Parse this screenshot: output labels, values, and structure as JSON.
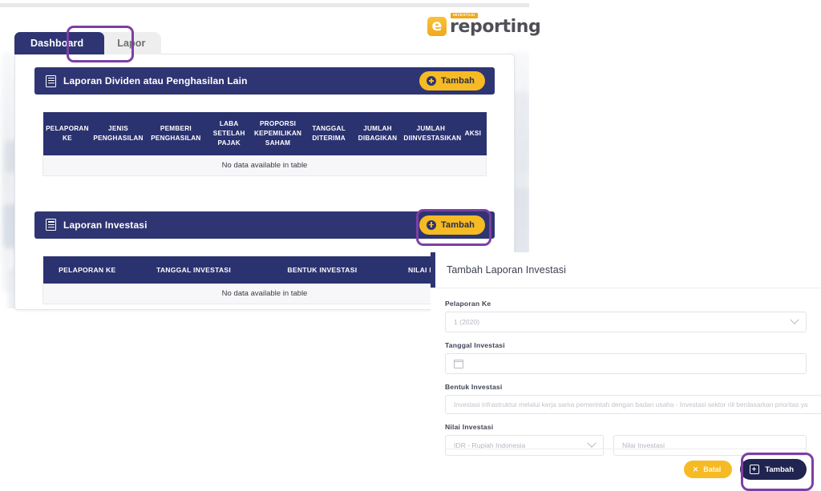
{
  "brand": {
    "mark_letter": "e",
    "badge": "INVESTASI",
    "word": "reporting"
  },
  "tabs": [
    {
      "label": "Dashboard",
      "state": "active"
    },
    {
      "label": "Lapor",
      "state": "highlighted"
    }
  ],
  "colors": {
    "navy": "#2e3572",
    "table_header_navy": "#2b3270",
    "amber": "#f6ba24",
    "highlight_purple": "#7c3fa5",
    "dark_button": "#1f2450"
  },
  "panels": [
    {
      "title": "Laporan Dividen atau Penghasilan Lain",
      "icon": "document-icon",
      "add_button": "Tambah",
      "table": {
        "columns": [
          "PELAPORAN KE",
          "JENIS PENGHASILAN",
          "PEMBERI PENGHASILAN",
          "LABA SETELAH PAJAK",
          "PROPORSI KEPEMILIKAN SAHAM",
          "TANGGAL DITERIMA",
          "JUMLAH DIBAGIKAN",
          "JUMLAH DIINVESTASIKAN",
          "AKSI"
        ],
        "empty_message": "No data available in table",
        "rows": []
      }
    },
    {
      "title": "Laporan Investasi",
      "icon": "document-icon",
      "add_button": "Tambah",
      "table": {
        "columns": [
          "PELAPORAN KE",
          "TANGGAL INVESTASI",
          "BENTUK INVESTASI",
          "NILAI INVESTASI"
        ],
        "empty_message": "No data available in table",
        "rows": []
      }
    }
  ],
  "side_form": {
    "heading": "Tambah Laporan Investasi",
    "fields": {
      "pelaporan_ke": {
        "label": "Pelaporan Ke",
        "value": "1 (2020)"
      },
      "tanggal_investasi": {
        "label": "Tanggal Investasi",
        "value": ""
      },
      "bentuk_investasi": {
        "label": "Bentuk Investasi",
        "value": "Investasi infrastruktur melalui kerja sama pemerintah dengan badan usaha - Investasi sektor riil berdasarkan prioritas ya"
      },
      "nilai_investasi": {
        "label": "Nilai Investasi",
        "currency": "IDR - Rupiah Indonesia",
        "placeholder": "Nilai Investasi",
        "value": ""
      }
    },
    "footer": {
      "cancel_label": "Batal",
      "submit_label": "Tambah"
    }
  }
}
